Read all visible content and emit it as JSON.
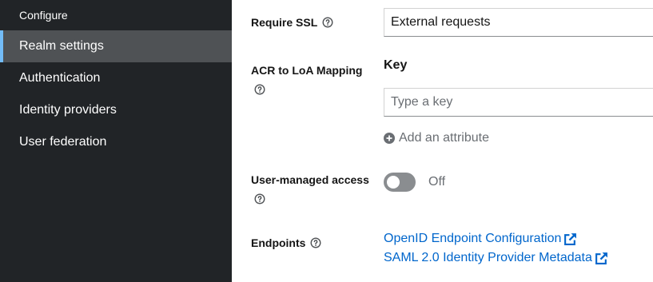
{
  "sidebar": {
    "section_title": "Configure",
    "items": [
      {
        "label": "Realm settings",
        "active": true
      },
      {
        "label": "Authentication",
        "active": false
      },
      {
        "label": "Identity providers",
        "active": false
      },
      {
        "label": "User federation",
        "active": false
      }
    ]
  },
  "form": {
    "require_ssl": {
      "label": "Require SSL",
      "value": "External requests"
    },
    "acr_mapping": {
      "label": "ACR to LoA Mapping",
      "key_header": "Key",
      "key_placeholder": "Type a key",
      "add_attribute_label": "Add an attribute"
    },
    "user_managed_access": {
      "label": "User-managed access",
      "state_label": "Off",
      "enabled": false
    },
    "endpoints": {
      "label": "Endpoints",
      "links": [
        {
          "label": "OpenID Endpoint Configuration"
        },
        {
          "label": "SAML 2.0 Identity Provider Metadata"
        }
      ]
    }
  },
  "colors": {
    "sidebar_bg": "#212427",
    "active_bg": "#4f5255",
    "active_accent": "#73bcf7",
    "link": "#0066cc",
    "muted": "#6a6e73",
    "switch_off": "#8a8d90"
  },
  "icons": {
    "help": "question-circle-icon",
    "add": "plus-circle-icon",
    "external": "external-link-icon"
  }
}
